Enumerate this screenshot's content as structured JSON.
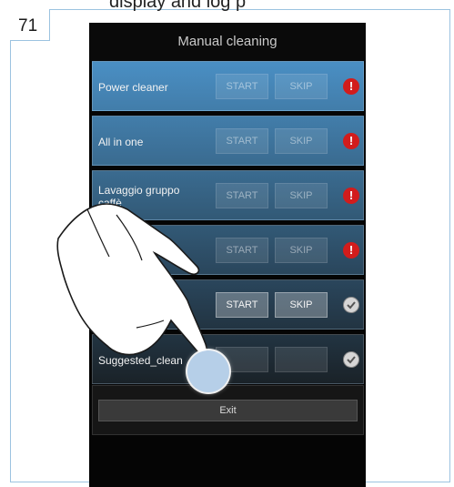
{
  "page": {
    "number": "71",
    "heading_fragment": "display and log p"
  },
  "screen": {
    "title": "Manual cleaning",
    "rows": [
      {
        "label": "Power cleaner",
        "start": "START",
        "skip": "SKIP",
        "status": "warning"
      },
      {
        "label": "All in one",
        "start": "START",
        "skip": "SKIP",
        "status": "warning"
      },
      {
        "label": "Lavaggio gruppo caffè",
        "start": "START",
        "skip": "SKIP",
        "status": "warning"
      },
      {
        "label": "",
        "start": "START",
        "skip": "SKIP",
        "status": "warning"
      },
      {
        "label": "",
        "start": "START",
        "skip": "SKIP",
        "status": "ok"
      },
      {
        "label": "Suggested_clean",
        "start": "",
        "skip": "",
        "status": "ok"
      }
    ],
    "exit_label": "Exit"
  },
  "colors": {
    "row_gradient_top": "#4a8fc4",
    "row_gradient_bottom": "#1a2228",
    "warning": "#d21c1c",
    "touch_point": "#b6cfe8"
  }
}
